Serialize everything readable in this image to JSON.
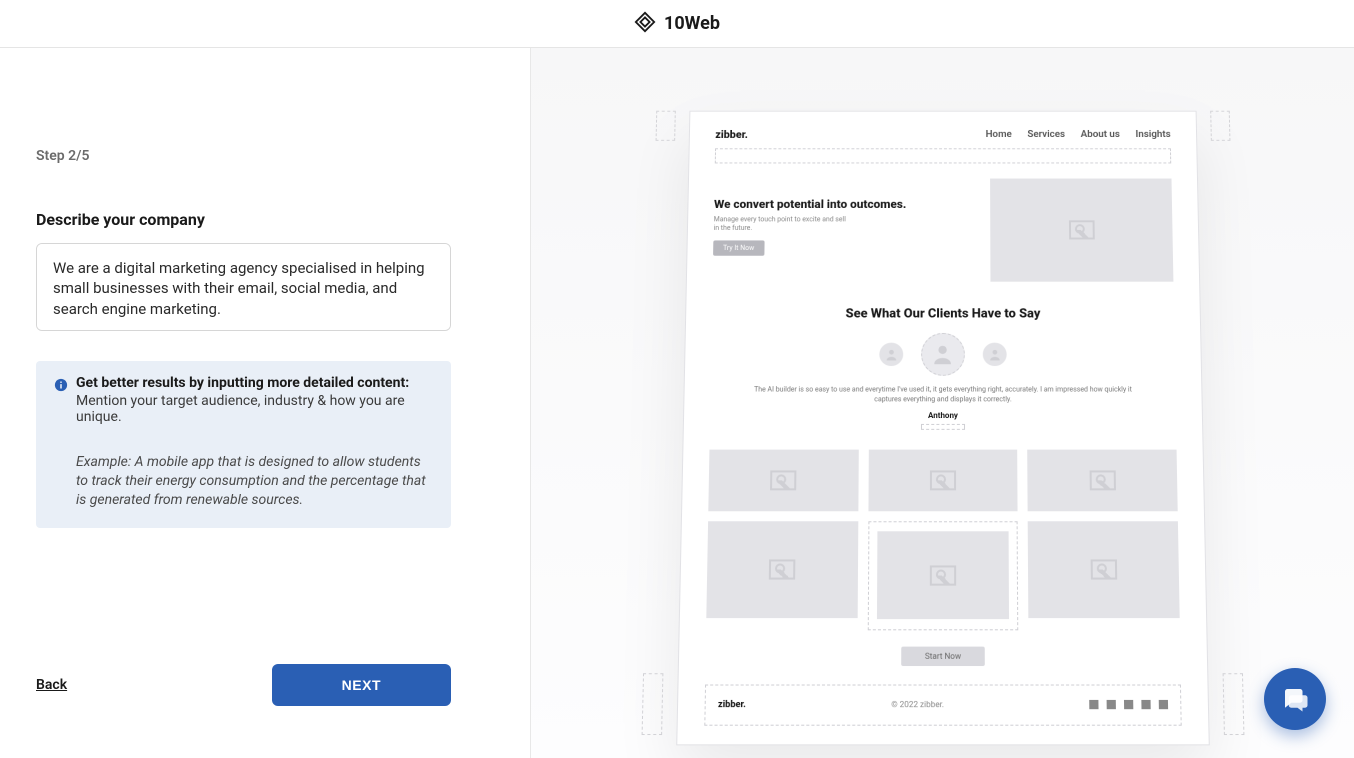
{
  "header": {
    "brand": "10Web"
  },
  "form": {
    "step_label": "Step 2/5",
    "title": "Describe your company",
    "textarea_value": "We are a digital marketing agency specialised in helping small businesses with their email, social media, and search engine marketing."
  },
  "tip": {
    "title": "Get better results by inputting more detailed content:",
    "sub": "Mention your target audience, industry & how you are unique.",
    "example": "Example: A mobile app that is designed to allow students to track their energy consumption and the percentage that is generated from renewable sources."
  },
  "actions": {
    "back": "Back",
    "next": "NEXT"
  },
  "preview": {
    "logo": "zibber.",
    "menu": [
      "Home",
      "Services",
      "About us",
      "Insights"
    ],
    "hero_title": "We convert potential into outcomes.",
    "hero_sub": "Manage every touch point to excite and sell in the future.",
    "hero_cta": "Try It Now",
    "testimonials_title": "See What Our Clients Have to Say",
    "quote": "The AI builder is so easy to use and everytime I've used it, it gets everything right, accurately. I am impressed how quickly it captures everything and displays it correctly.",
    "author": "Anthony",
    "start_now": "Start Now",
    "footer_logo": "zibber.",
    "copyright": "© 2022 zibber."
  }
}
